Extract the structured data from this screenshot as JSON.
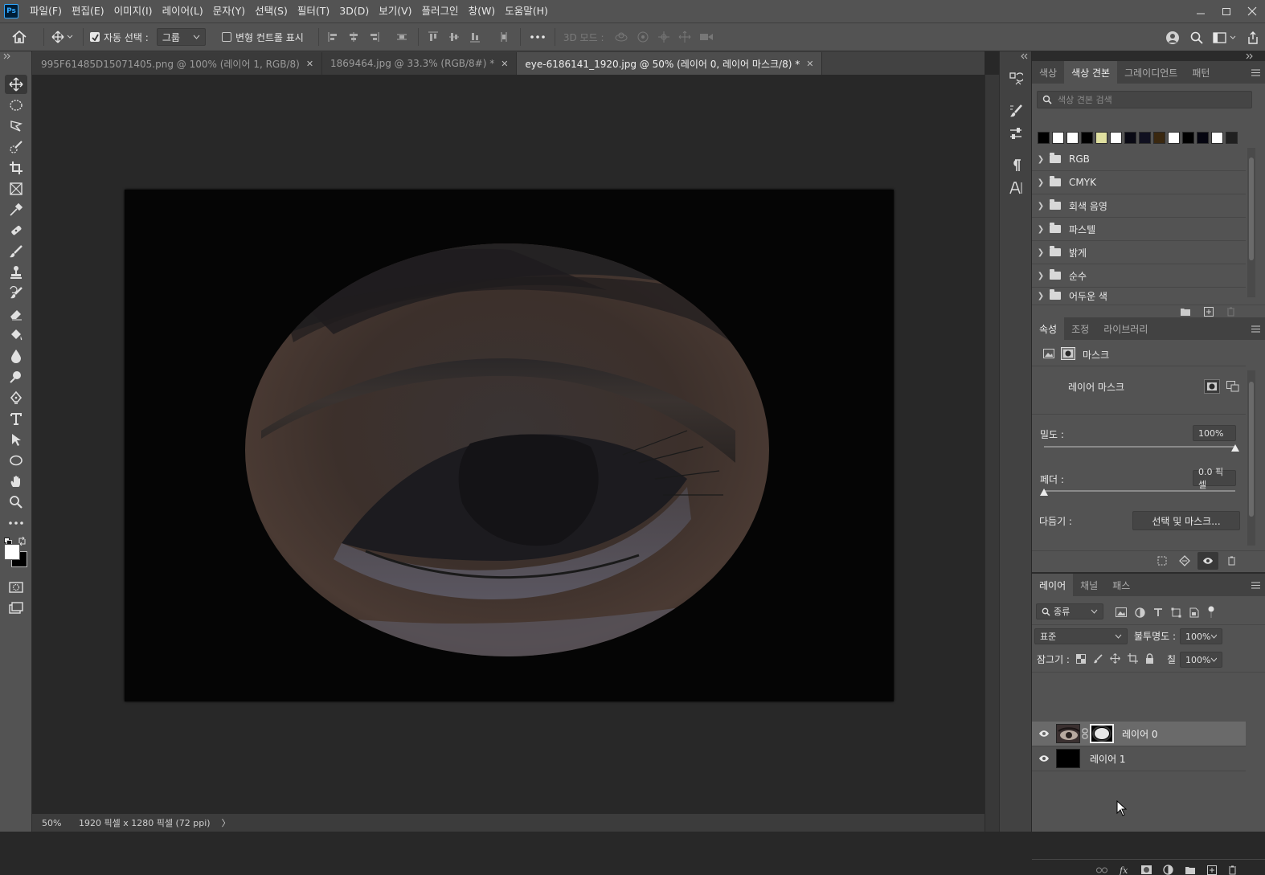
{
  "app": {
    "logo": "Ps"
  },
  "menubar": {
    "items": [
      "파일(F)",
      "편집(E)",
      "이미지(I)",
      "레이어(L)",
      "문자(Y)",
      "선택(S)",
      "필터(T)",
      "3D(D)",
      "보기(V)",
      "플러그인",
      "창(W)",
      "도움말(H)"
    ],
    "window_controls": [
      "minimize-icon",
      "restore-icon",
      "close-icon"
    ]
  },
  "options": {
    "auto_select_label": "자동 선택 :",
    "auto_select_checked": true,
    "auto_select_target": "그룹",
    "transform_controls_label": "변형 컨트롤 표시",
    "transform_controls_checked": false,
    "mode3d_label": "3D 모드 :"
  },
  "tabs": [
    {
      "title": "995F61485D15071405.png @ 100% (레이어 1, RGB/8)",
      "active": false
    },
    {
      "title": "1869464.jpg @ 33.3% (RGB/8#) *",
      "active": false
    },
    {
      "title": "eye-6186141_1920.jpg @ 50% (레이어 0, 레이어 마스크/8) *",
      "active": true
    }
  ],
  "status": {
    "zoom": "50%",
    "doc_info": "1920 픽셀 x 1280 픽셀 (72 ppi)",
    "more": "〉"
  },
  "swatches_panel": {
    "tabs": [
      "색상",
      "색상 견본",
      "그레이디언트",
      "패턴"
    ],
    "active_tab": "색상 견본",
    "search_placeholder": "색상 견본 검색",
    "recent_colors": [
      "#000000",
      "#ffffff",
      "#ffffff",
      "#000000",
      "#e0e0a0",
      "#ffffff",
      "#0a0a14",
      "#101020",
      "#3a2810",
      "#ffffff",
      "#000000",
      "#050510",
      "#ffffff",
      "#202020"
    ],
    "groups": [
      "RGB",
      "CMYK",
      "회색 음영",
      "파스텔",
      "밝게",
      "순수",
      "어두운 색"
    ]
  },
  "properties_panel": {
    "tabs": [
      "속성",
      "조정",
      "라이브러리"
    ],
    "active_tab": "속성",
    "mask_label": "마스크",
    "layer_mask_label": "레이어 마스크",
    "density_label": "밀도 :",
    "density_value": "100%",
    "density_level": 1.0,
    "feather_label": "페더 :",
    "feather_value": "0.0 픽셀",
    "feather_level": 0.0,
    "refine_label": "다듬기 :",
    "select_mask_button": "선택 및 마스크..."
  },
  "layers_panel": {
    "tabs": [
      "레이어",
      "채널",
      "패스"
    ],
    "active_tab": "레이어",
    "filter_kind": "종류",
    "blend_mode": "표준",
    "opacity_label": "불투명도 :",
    "opacity_value": "100%",
    "lock_label": "잠그기 :",
    "fill_label": "칠 :",
    "fill_value": "100%",
    "layers": [
      {
        "name": "레이어 0",
        "visible": true,
        "selected": true,
        "has_mask": true
      },
      {
        "name": "레이어 1",
        "visible": true,
        "selected": false,
        "has_mask": false
      }
    ]
  },
  "colors": {
    "accent": "#31a8ff",
    "panel_bg": "#535353",
    "canvas_bg": "#282828"
  }
}
